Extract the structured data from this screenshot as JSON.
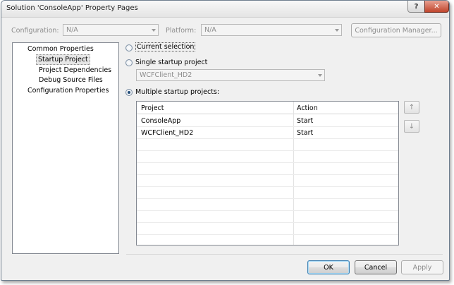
{
  "window": {
    "title": "Solution 'ConsoleApp' Property Pages",
    "help_glyph": "?",
    "close_glyph": "✕"
  },
  "toolbar": {
    "configuration_label": "Configuration:",
    "configuration_value": "N/A",
    "platform_label": "Platform:",
    "platform_value": "N/A",
    "configuration_manager_label": "Configuration Manager..."
  },
  "tree": {
    "items": [
      {
        "label": "Common Properties"
      },
      {
        "label": "Startup Project",
        "selected": true
      },
      {
        "label": "Project Dependencies"
      },
      {
        "label": "Debug Source Files"
      },
      {
        "label": "Configuration Properties"
      }
    ]
  },
  "startup": {
    "current_selection_label": "Current selection",
    "single_startup_label": "Single startup project",
    "single_startup_value": "WCFClient_HD2",
    "multiple_startup_label": "Multiple startup projects:",
    "selected_option": "multiple"
  },
  "grid": {
    "columns": [
      "Project",
      "Action"
    ],
    "rows": [
      {
        "project": "ConsoleApp",
        "action": "Start"
      },
      {
        "project": "WCFClient_HD2",
        "action": "Start"
      }
    ]
  },
  "icons": {
    "move_up": "arrow-up-icon",
    "move_down": "arrow-down-icon"
  },
  "buttons": {
    "ok": "OK",
    "cancel": "Cancel",
    "apply": "Apply"
  }
}
